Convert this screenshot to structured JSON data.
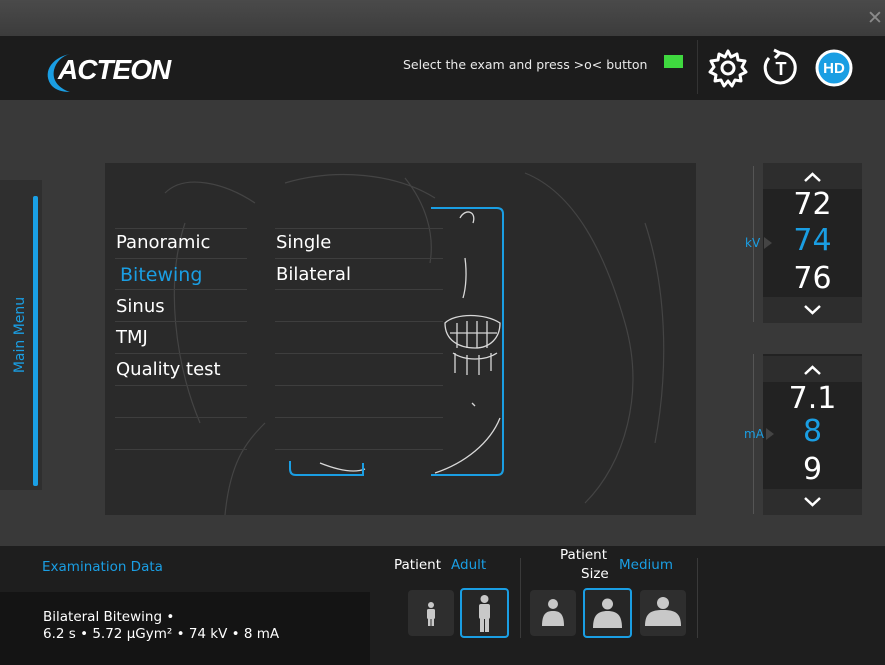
{
  "header": {
    "logo": "ACTEON",
    "instruction": "Select the exam and press >o< button",
    "led_color": "#3fd83f",
    "icons": [
      "settings-icon",
      "rotate-t-icon",
      "hd-icon"
    ],
    "hd_label": "HD"
  },
  "window": {
    "close_symbol": "✕"
  },
  "main_menu": {
    "label": "Main Menu"
  },
  "exam_types": [
    {
      "label": "Panoramic",
      "selected": false
    },
    {
      "label": "Bitewing",
      "selected": true
    },
    {
      "label": "Sinus",
      "selected": false
    },
    {
      "label": "TMJ",
      "selected": false
    },
    {
      "label": "Quality test",
      "selected": false
    }
  ],
  "exam_modes": [
    {
      "label": "Single",
      "selected": false
    },
    {
      "label": "Bilateral",
      "selected": true
    }
  ],
  "kv": {
    "unit": "kV",
    "values": [
      "72",
      "74",
      "76"
    ],
    "active": "74"
  },
  "ma": {
    "unit": "mA",
    "values": [
      "7.1",
      "8",
      "9"
    ],
    "active": "8"
  },
  "footer": {
    "exam_data_title": "Examination Data",
    "exam_line1": "Bilateral Bitewing •",
    "exam_line2": "6.2 s • 5.72 µGym² • 74 kV • 8 mA",
    "patient_label": "Patient",
    "patient_value": "Adult",
    "patient_size_label_1": "Patient",
    "patient_size_label_2": "Size",
    "patient_size_value": "Medium",
    "patient_types": [
      {
        "name": "child",
        "selected": false
      },
      {
        "name": "adult",
        "selected": true
      }
    ],
    "patient_sizes": [
      {
        "name": "small",
        "selected": false
      },
      {
        "name": "medium",
        "selected": true
      },
      {
        "name": "large",
        "selected": false
      }
    ]
  },
  "colors": {
    "accent": "#1a9ee3",
    "background": "#393939",
    "header": "#1c1c1c",
    "panel": "#2a2a2a"
  }
}
